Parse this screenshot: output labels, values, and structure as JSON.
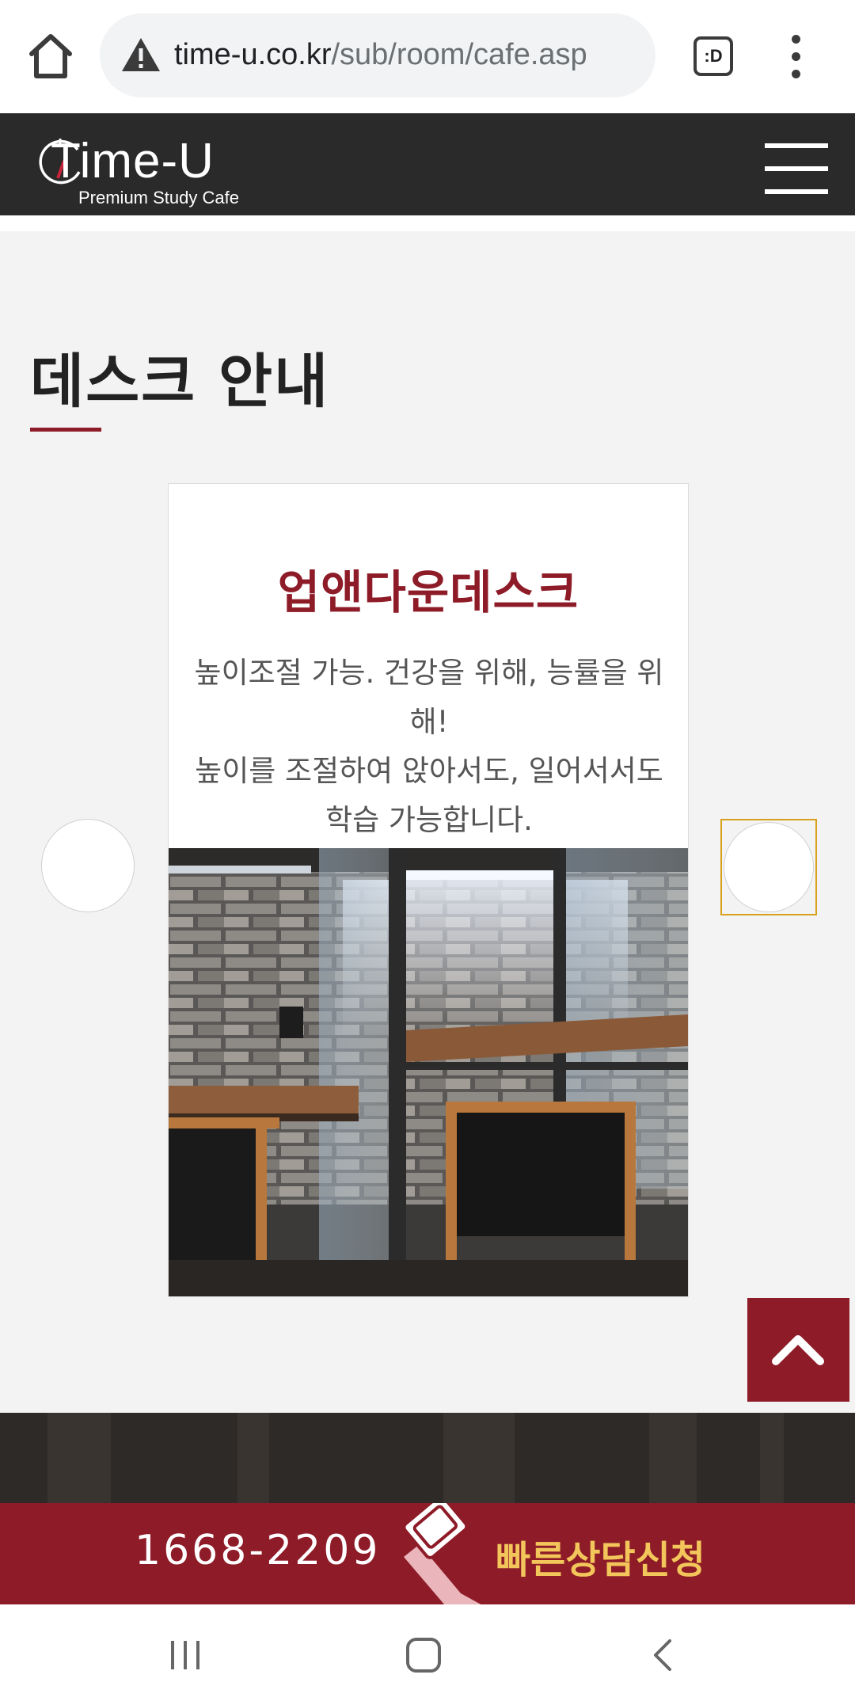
{
  "browser": {
    "url_host": "time-u.co.kr",
    "url_path": "/sub/room/cafe.asp",
    "tab_switcher_label": ":D"
  },
  "site": {
    "logo_word": "Time-U",
    "logo_sub": "Premium Study Cafe"
  },
  "section": {
    "title": "데스크 안내"
  },
  "card": {
    "title": "업앤다운데스크",
    "desc_line1": "높이조절 가능. 건강을 위해, 능률을 위해!",
    "desc_line2": "높이를 조절하여 앉아서도, 일어서서도 학습 가능합니다."
  },
  "cta": {
    "phone": "1668-2209",
    "consult": "빠른상담신청"
  },
  "colors": {
    "brand": "#8e1b28",
    "header_bg": "#2a2a2a",
    "cta_accent": "#f2c65a",
    "focus_ring": "#d9a11b"
  }
}
